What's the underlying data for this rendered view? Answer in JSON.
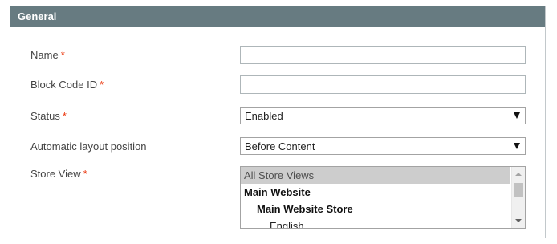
{
  "panel": {
    "title": "General"
  },
  "form": {
    "required_marker": "*",
    "name": {
      "label": "Name",
      "value": ""
    },
    "block_code_id": {
      "label": "Block Code ID",
      "value": ""
    },
    "status": {
      "label": "Status",
      "value": "Enabled"
    },
    "layout_position": {
      "label": "Automatic layout position",
      "value": "Before Content"
    },
    "store_view": {
      "label": "Store View",
      "options": [
        "All Store Views",
        "Main Website",
        "Main Website Store",
        "English"
      ],
      "selected": "All Store Views"
    }
  },
  "colors": {
    "header_bg": "#677b81",
    "required": "#eb340a",
    "selected_option_bg": "#cdcdcd"
  }
}
